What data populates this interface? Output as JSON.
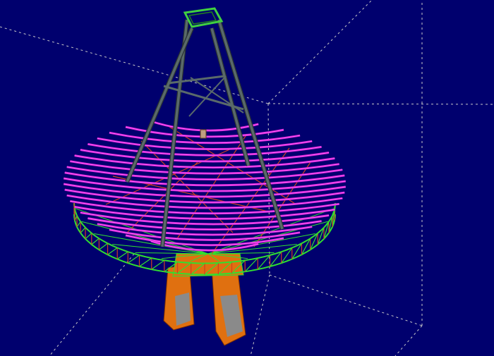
{
  "scene": {
    "background_color": "#00006e",
    "bounding_box_color": "#c8c8c8",
    "colors": {
      "dish_ribs": "#d020d0",
      "dish_ribs_highlight": "#ff60ff",
      "backing_truss": "#30e030",
      "diagonal_bracing": "#d04020",
      "quadripod_legs": "#5a6a6a",
      "apex_frame": "#40d040",
      "pedestal": "#e07010",
      "pedestal_shadow": "#8a8a8a"
    }
  }
}
